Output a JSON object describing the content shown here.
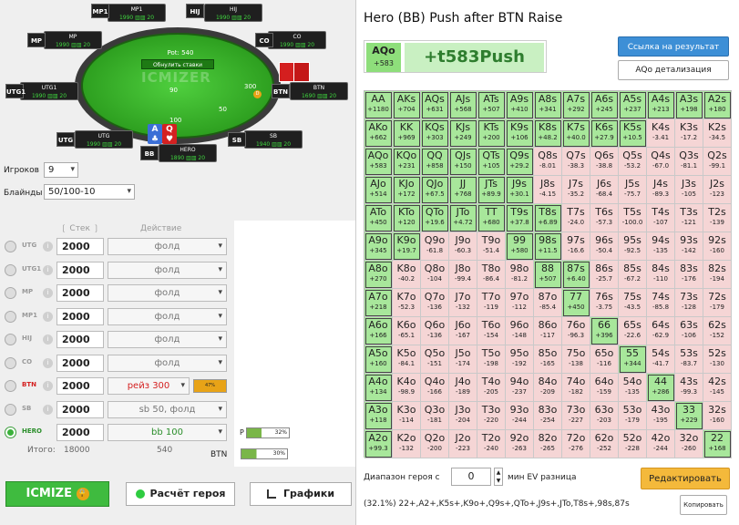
{
  "table": {
    "pot": "Pot: 540",
    "reset": "Обнулить ставки",
    "watermark": "ICMIZER",
    "seats": [
      {
        "name": "MP1",
        "stack": "1990 ▥▥ 20",
        "tag": "MP1"
      },
      {
        "name": "HIJ",
        "stack": "1990 ▥▥ 20",
        "tag": "HIJ"
      },
      {
        "name": "MP",
        "stack": "1990 ▥▥ 20",
        "tag": "MP"
      },
      {
        "name": "CO",
        "stack": "1990 ▥▥ 20",
        "tag": "CO"
      },
      {
        "name": "UTG1",
        "stack": "1990 ▥▥ 20",
        "tag": "UTG1"
      },
      {
        "name": "BTN",
        "stack": "1690 ▥▥ 20",
        "tag": "BTN"
      },
      {
        "name": "UTG",
        "stack": "1990 ▥▥ 20",
        "tag": "UTG"
      },
      {
        "name": "SB",
        "stack": "1940 ▥▥ 20",
        "tag": "SB"
      },
      {
        "name": "HERO",
        "stack": "1890 ▥▥ 20",
        "tag": "BB"
      }
    ],
    "chips": {
      "hero_bet": "100",
      "btn_bet": "300",
      "sb_bet": "50",
      "mid_bet": "90"
    },
    "hero_cards": [
      {
        "rank": "A",
        "suit": "♣",
        "color": "#3b6fd6"
      },
      {
        "rank": "Q",
        "suit": "♥",
        "color": "#d42121"
      }
    ]
  },
  "settings": {
    "players_label": "Игроков",
    "players_value": "9",
    "blinds_label": "Блайнды",
    "blinds_value": "50/100-10"
  },
  "columns": {
    "stack": "Стек",
    "action": "Действие"
  },
  "players": [
    {
      "name": "UTG",
      "stack": "2000",
      "action": "фолд"
    },
    {
      "name": "UTG1",
      "stack": "2000",
      "action": "фолд"
    },
    {
      "name": "MP",
      "stack": "2000",
      "action": "фолд"
    },
    {
      "name": "MP1",
      "stack": "2000",
      "action": "фолд"
    },
    {
      "name": "HIJ",
      "stack": "2000",
      "action": "фолд"
    },
    {
      "name": "CO",
      "stack": "2000",
      "action": "фолд"
    },
    {
      "name": "BTN",
      "stack": "2000",
      "action": "рейз 300",
      "pct": "47%"
    },
    {
      "name": "SB",
      "stack": "2000",
      "action": "sb 50, фолд"
    },
    {
      "name": "HERO",
      "stack": "2000",
      "action": "bb 100"
    }
  ],
  "totals": {
    "label": "Итого:",
    "stack": "18000",
    "action": "540"
  },
  "bars": {
    "p_label": "P",
    "p_value": "32%",
    "btn_label": "BTN",
    "btn_value": "30%"
  },
  "buttons": {
    "icmize": "ICMIZE",
    "hero_calc": "Расчёт героя",
    "graphs": "Графики"
  },
  "right": {
    "title": "Hero (BB) Push after BTN Raise",
    "hand": "AQo",
    "hand_ev": "+583",
    "result": "+t583Push",
    "link_btn": "Ссылка на результат",
    "detail_btn": "AQo детализация",
    "range_label": "Диапазон героя с",
    "range_value": "0",
    "range_suffix": "мин EV разница",
    "edit_btn": "Редактировать",
    "copy_btn": "Копировать",
    "range_text": "(32.1%) 22+,A2+,K5s+,K9o+,Q9s+,QTo+,J9s+,JTo,T8s+,98s,87s"
  },
  "grid": [
    [
      [
        "AA",
        "+1180",
        1
      ],
      [
        "AKs",
        "+704",
        1
      ],
      [
        "AQs",
        "+631",
        1
      ],
      [
        "AJs",
        "+568",
        1
      ],
      [
        "ATs",
        "+507",
        1
      ],
      [
        "A9s",
        "+410",
        1
      ],
      [
        "A8s",
        "+341",
        1
      ],
      [
        "A7s",
        "+292",
        1
      ],
      [
        "A6s",
        "+245",
        1
      ],
      [
        "A5s",
        "+237",
        1
      ],
      [
        "A4s",
        "+213",
        1
      ],
      [
        "A3s",
        "+198",
        1
      ],
      [
        "A2s",
        "+180",
        1
      ]
    ],
    [
      [
        "AKo",
        "+662",
        1
      ],
      [
        "KK",
        "+969",
        1
      ],
      [
        "KQs",
        "+303",
        1
      ],
      [
        "KJs",
        "+249",
        1
      ],
      [
        "KTs",
        "+200",
        1
      ],
      [
        "K9s",
        "+106",
        1
      ],
      [
        "K8s",
        "+48.2",
        1
      ],
      [
        "K7s",
        "+40.0",
        1
      ],
      [
        "K6s",
        "+27.9",
        1
      ],
      [
        "K5s",
        "+10.5",
        1
      ],
      [
        "K4s",
        "-3.41",
        0
      ],
      [
        "K3s",
        "-17.2",
        0
      ],
      [
        "K2s",
        "-34.5",
        0
      ]
    ],
    [
      [
        "AQo",
        "+583",
        1
      ],
      [
        "KQo",
        "+231",
        1
      ],
      [
        "QQ",
        "+858",
        1
      ],
      [
        "QJs",
        "+150",
        1
      ],
      [
        "QTs",
        "+105",
        1
      ],
      [
        "Q9s",
        "+29.2",
        1
      ],
      [
        "Q8s",
        "-8.01",
        0
      ],
      [
        "Q7s",
        "-38.3",
        0
      ],
      [
        "Q6s",
        "-38.8",
        0
      ],
      [
        "Q5s",
        "-53.2",
        0
      ],
      [
        "Q4s",
        "-67.0",
        0
      ],
      [
        "Q3s",
        "-81.1",
        0
      ],
      [
        "Q2s",
        "-99.1",
        0
      ]
    ],
    [
      [
        "AJo",
        "+514",
        1
      ],
      [
        "KJo",
        "+172",
        1
      ],
      [
        "QJo",
        "+67.5",
        1
      ],
      [
        "JJ",
        "+768",
        1
      ],
      [
        "JTs",
        "+89.9",
        1
      ],
      [
        "J9s",
        "+30.1",
        1
      ],
      [
        "J8s",
        "-4.15",
        0
      ],
      [
        "J7s",
        "-35.2",
        0
      ],
      [
        "J6s",
        "-68.4",
        0
      ],
      [
        "J5s",
        "-75.7",
        0
      ],
      [
        "J4s",
        "-89.3",
        0
      ],
      [
        "J3s",
        "-105",
        0
      ],
      [
        "J2s",
        "-123",
        0
      ]
    ],
    [
      [
        "ATo",
        "+450",
        1
      ],
      [
        "KTo",
        "+120",
        1
      ],
      [
        "QTo",
        "+19.6",
        1
      ],
      [
        "JTo",
        "+4.72",
        1
      ],
      [
        "TT",
        "+680",
        1
      ],
      [
        "T9s",
        "+37.8",
        1
      ],
      [
        "T8s",
        "+6.89",
        1
      ],
      [
        "T7s",
        "-24.0",
        0
      ],
      [
        "T6s",
        "-57.3",
        0
      ],
      [
        "T5s",
        "-100.0",
        0
      ],
      [
        "T4s",
        "-107",
        0
      ],
      [
        "T3s",
        "-121",
        0
      ],
      [
        "T2s",
        "-139",
        0
      ]
    ],
    [
      [
        "A9o",
        "+345",
        1
      ],
      [
        "K9o",
        "+19.7",
        1
      ],
      [
        "Q9o",
        "-61.8",
        0
      ],
      [
        "J9o",
        "-60.3",
        0
      ],
      [
        "T9o",
        "-51.4",
        0
      ],
      [
        "99",
        "+580",
        1
      ],
      [
        "98s",
        "+11.5",
        1
      ],
      [
        "97s",
        "-16.6",
        0
      ],
      [
        "96s",
        "-50.4",
        0
      ],
      [
        "95s",
        "-92.5",
        0
      ],
      [
        "94s",
        "-135",
        0
      ],
      [
        "93s",
        "-142",
        0
      ],
      [
        "92s",
        "-160",
        0
      ]
    ],
    [
      [
        "A8o",
        "+270",
        1
      ],
      [
        "K8o",
        "-40.2",
        0
      ],
      [
        "Q8o",
        "-104",
        0
      ],
      [
        "J8o",
        "-99.4",
        0
      ],
      [
        "T8o",
        "-86.4",
        0
      ],
      [
        "98o",
        "-81.2",
        0
      ],
      [
        "88",
        "+507",
        1
      ],
      [
        "87s",
        "+6.40",
        1
      ],
      [
        "86s",
        "-25.7",
        0
      ],
      [
        "85s",
        "-67.2",
        0
      ],
      [
        "84s",
        "-110",
        0
      ],
      [
        "83s",
        "-176",
        0
      ],
      [
        "82s",
        "-194",
        0
      ]
    ],
    [
      [
        "A7o",
        "+218",
        1
      ],
      [
        "K7o",
        "-52.3",
        0
      ],
      [
        "Q7o",
        "-136",
        0
      ],
      [
        "J7o",
        "-132",
        0
      ],
      [
        "T7o",
        "-119",
        0
      ],
      [
        "97o",
        "-112",
        0
      ],
      [
        "87o",
        "-85.4",
        0
      ],
      [
        "77",
        "+450",
        1
      ],
      [
        "76s",
        "-3.75",
        0
      ],
      [
        "75s",
        "-43.5",
        0
      ],
      [
        "74s",
        "-85.8",
        0
      ],
      [
        "73s",
        "-128",
        0
      ],
      [
        "72s",
        "-179",
        0
      ]
    ],
    [
      [
        "A6o",
        "+166",
        1
      ],
      [
        "K6o",
        "-65.1",
        0
      ],
      [
        "Q6o",
        "-136",
        0
      ],
      [
        "J6o",
        "-167",
        0
      ],
      [
        "T6o",
        "-154",
        0
      ],
      [
        "96o",
        "-148",
        0
      ],
      [
        "86o",
        "-117",
        0
      ],
      [
        "76o",
        "-96.3",
        0
      ],
      [
        "66",
        "+396",
        1
      ],
      [
        "65s",
        "-22.6",
        0
      ],
      [
        "64s",
        "-62.9",
        0
      ],
      [
        "63s",
        "-106",
        0
      ],
      [
        "62s",
        "-152",
        0
      ]
    ],
    [
      [
        "A5o",
        "+160",
        1
      ],
      [
        "K5o",
        "-84.1",
        0
      ],
      [
        "Q5o",
        "-151",
        0
      ],
      [
        "J5o",
        "-174",
        0
      ],
      [
        "T5o",
        "-198",
        0
      ],
      [
        "95o",
        "-192",
        0
      ],
      [
        "85o",
        "-165",
        0
      ],
      [
        "75o",
        "-138",
        0
      ],
      [
        "65o",
        "-116",
        0
      ],
      [
        "55",
        "+344",
        1
      ],
      [
        "54s",
        "-41.7",
        0
      ],
      [
        "53s",
        "-83.7",
        0
      ],
      [
        "52s",
        "-130",
        0
      ]
    ],
    [
      [
        "A4o",
        "+134",
        1
      ],
      [
        "K4o",
        "-98.9",
        0
      ],
      [
        "Q4o",
        "-166",
        0
      ],
      [
        "J4o",
        "-189",
        0
      ],
      [
        "T4o",
        "-205",
        0
      ],
      [
        "94o",
        "-237",
        0
      ],
      [
        "84o",
        "-209",
        0
      ],
      [
        "74o",
        "-182",
        0
      ],
      [
        "64o",
        "-159",
        0
      ],
      [
        "54o",
        "-135",
        0
      ],
      [
        "44",
        "+286",
        1
      ],
      [
        "43s",
        "-99.3",
        0
      ],
      [
        "42s",
        "-145",
        0
      ]
    ],
    [
      [
        "A3o",
        "+118",
        1
      ],
      [
        "K3o",
        "-114",
        0
      ],
      [
        "Q3o",
        "-181",
        0
      ],
      [
        "J3o",
        "-204",
        0
      ],
      [
        "T3o",
        "-220",
        0
      ],
      [
        "93o",
        "-244",
        0
      ],
      [
        "83o",
        "-254",
        0
      ],
      [
        "73o",
        "-227",
        0
      ],
      [
        "63o",
        "-203",
        0
      ],
      [
        "53o",
        "-179",
        0
      ],
      [
        "43o",
        "-195",
        0
      ],
      [
        "33",
        "+229",
        1
      ],
      [
        "32s",
        "-160",
        0
      ]
    ],
    [
      [
        "A2o",
        "+99.3",
        1
      ],
      [
        "K2o",
        "-132",
        0
      ],
      [
        "Q2o",
        "-200",
        0
      ],
      [
        "J2o",
        "-223",
        0
      ],
      [
        "T2o",
        "-240",
        0
      ],
      [
        "92o",
        "-263",
        0
      ],
      [
        "82o",
        "-265",
        0
      ],
      [
        "72o",
        "-276",
        0
      ],
      [
        "62o",
        "-252",
        0
      ],
      [
        "52o",
        "-228",
        0
      ],
      [
        "42o",
        "-244",
        0
      ],
      [
        "32o",
        "-260",
        0
      ],
      [
        "22",
        "+168",
        1
      ]
    ]
  ]
}
